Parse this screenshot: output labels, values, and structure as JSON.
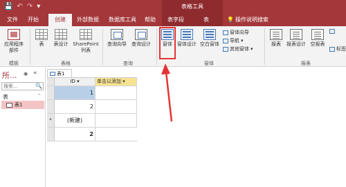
{
  "titlebar": {
    "qat": {
      "save_icon": "save-icon",
      "undo_icon": "↶",
      "redo_icon": "↷",
      "customize_icon": "▾"
    },
    "context_title": "表格工具"
  },
  "tabs": [
    "文件",
    "开始",
    "创建",
    "外部数据",
    "数据库工具",
    "帮助",
    "表字段",
    "表",
    "操作说明搜索"
  ],
  "tell_me_icon": "lightbulb-icon",
  "ribbon": {
    "templates": {
      "app_parts": "应用程序\n部件",
      "group": "模板"
    },
    "tables": {
      "table": "表",
      "table_design": "表设计",
      "sharepoint": "SharePoint\n列表",
      "group": "表格"
    },
    "queries": {
      "query_wizard": "查询向导",
      "query_design": "查询设计",
      "group": "查询"
    },
    "forms": {
      "form": "窗体",
      "form_design": "窗体设计",
      "blank_form": "空白窗体",
      "form_wizard": "窗体向导",
      "navigation": "导航",
      "more_forms": "其他窗体",
      "group": "窗体"
    },
    "reports": {
      "report": "报表",
      "report_design": "报表设计",
      "blank_report": "空报表",
      "labels": "标签",
      "group": "报表"
    }
  },
  "nav_pane": {
    "title": "所...",
    "search_placeholder": "搜索...",
    "section": "表",
    "items": [
      {
        "label": "表1"
      }
    ]
  },
  "document": {
    "tab_label": "表1",
    "header": {
      "id": "ID",
      "add": "单击以添加"
    },
    "rows": [
      {
        "marker": "",
        "id": "1"
      },
      {
        "marker": "",
        "id": "2"
      },
      {
        "marker": "*",
        "id": "(新建)"
      },
      {
        "marker": "",
        "id": "2"
      }
    ]
  },
  "colors": {
    "accent": "#a4373a",
    "context_tab": "#8e2b2e",
    "highlight": "#e53333",
    "selected_nav": "#f4c3c4",
    "active_cell": "#b8cfe8",
    "add_column": "#f7e391"
  }
}
